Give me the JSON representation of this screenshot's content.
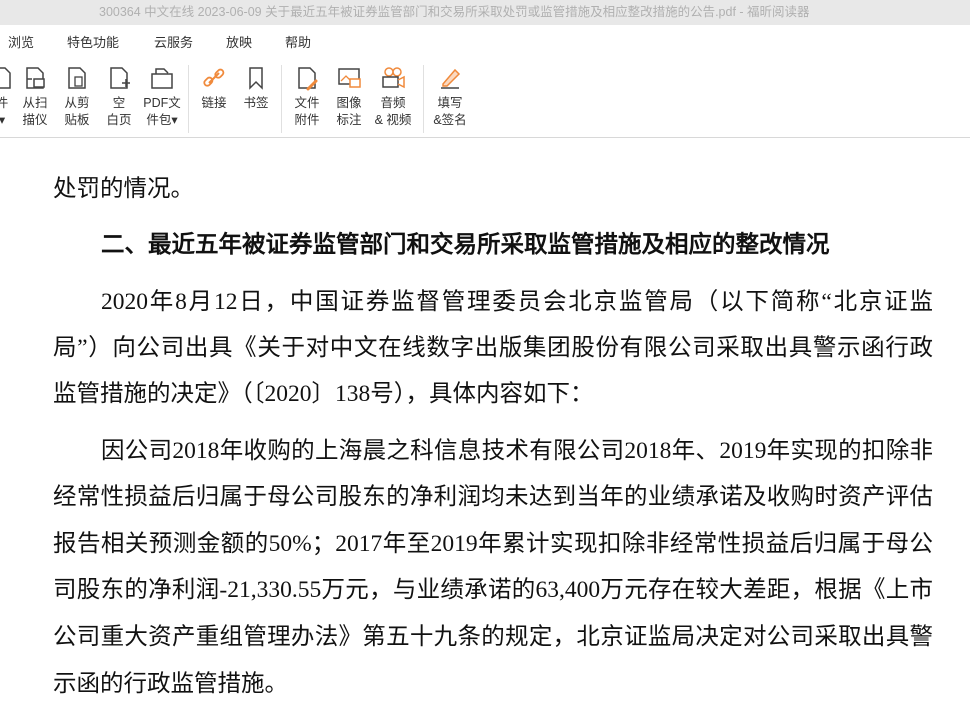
{
  "window": {
    "title": "300364 中文在线 2023-06-09 关于最近五年被证券监管部门和交易所采取处罚或监管措施及相应整改措施的公告.pdf - 福昕阅读器"
  },
  "menu": [
    "浏览",
    "特色功能",
    "云服务",
    "放映",
    "帮助"
  ],
  "toolbar": [
    {
      "l1": "件",
      "l2": "▾",
      "icon": "file-icon"
    },
    {
      "l1": "从扫",
      "l2": "描仪",
      "icon": "scanner-icon"
    },
    {
      "l1": "从剪",
      "l2": "贴板",
      "icon": "clipboard-icon"
    },
    {
      "l1": "空",
      "l2": "白页",
      "icon": "blank-page-icon"
    },
    {
      "l1": "PDF文",
      "l2": "件包▾",
      "icon": "pdf-package-icon"
    },
    {
      "l1": "链接",
      "l2": "",
      "icon": "link-icon"
    },
    {
      "l1": "书签",
      "l2": "",
      "icon": "bookmark-icon"
    },
    {
      "l1": "文件",
      "l2": "附件",
      "icon": "file-attachment-icon"
    },
    {
      "l1": "图像",
      "l2": "标注",
      "icon": "image-annotation-icon"
    },
    {
      "l1": "音频",
      "l2": "& 视频",
      "icon": "video-icon"
    },
    {
      "l1": "填写",
      "l2": "&签名",
      "icon": "fill-sign-icon"
    }
  ],
  "colors": {
    "accent": "#f08a3c"
  },
  "document": {
    "lines": [
      "处罚的情况。",
      "二、最近五年被证券监管部门和交易所采取监管措施及相应的整改情况",
      "2020年8月12日，中国证券监督管理委员会北京监管局（以下简称“北京证监",
      "局”）向公司出具《关于对中文在线数字出版集团股份有限公司采取出具警示函行政",
      "监管措施的决定》（〔2020〕138号），具体内容如下：",
      "因公司2018年收购的上海晨之科信息技术有限公司2018年、2019年实现的扣除非",
      "经常性损益后归属于母公司股东的净利润均未达到当年的业绩承诺及收购时资产评估",
      "报告相关预测金额的50%；2017年至2019年累计实现扣除非经常性损益后归属于母公",
      "司股东的净利润-21,330.55万元，与业绩承诺的63,400万元存在较大差距，根据《上市",
      "公司重大资产重组管理办法》第五十九条的规定，北京证监局决定对公司采取出具警",
      "示函的行政监管措施。"
    ]
  }
}
